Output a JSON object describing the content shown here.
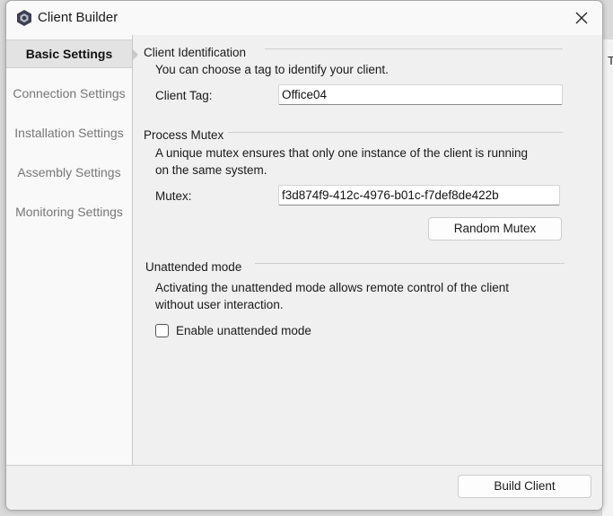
{
  "window": {
    "title": "Client Builder",
    "icon": "app-logo-icon",
    "close_icon": "close-icon"
  },
  "background": {
    "partial_text": "T:"
  },
  "nav": {
    "items": [
      {
        "label": "Basic Settings",
        "active": true
      },
      {
        "label": "Connection Settings",
        "active": false
      },
      {
        "label": "Installation Settings",
        "active": false
      },
      {
        "label": "Assembly Settings",
        "active": false
      },
      {
        "label": "Monitoring Settings",
        "active": false
      }
    ]
  },
  "identification": {
    "title": "Client Identification",
    "description": "You can choose a tag to identify your client.",
    "tag_label": "Client Tag:",
    "tag_value": "Office04"
  },
  "mutex": {
    "title": "Process Mutex",
    "description_line1": "A unique mutex ensures that only one instance of the client is running",
    "description_line2": "on the same system.",
    "label": "Mutex:",
    "value": "f3d874f9-412c-4976-b01c-f7def8de422b",
    "random_button": "Random Mutex"
  },
  "unattended": {
    "title": "Unattended mode",
    "description_line1": "Activating the unattended mode allows remote control of the client",
    "description_line2": "without user interaction.",
    "checkbox_label": "Enable unattended mode",
    "checked": false
  },
  "footer": {
    "build_button": "Build Client"
  },
  "colors": {
    "window_bg": "#f0f0f0",
    "nav_bg": "#f9f9f9",
    "nav_active_bg": "#e3e3e3"
  }
}
